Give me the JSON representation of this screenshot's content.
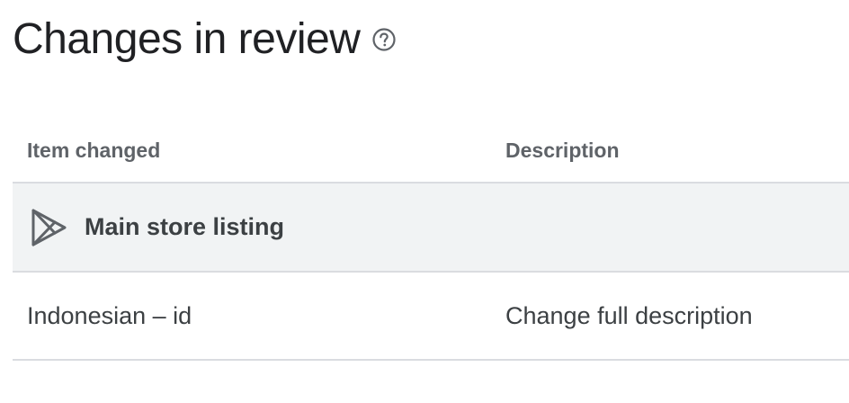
{
  "header": {
    "title": "Changes in review",
    "help_icon": "help-circle-icon"
  },
  "table": {
    "columns": [
      "Item changed",
      "Description"
    ],
    "group": {
      "icon": "google-play-icon",
      "label": "Main store listing"
    },
    "rows": [
      {
        "item": "Indonesian – id",
        "description": "Change full description"
      }
    ]
  },
  "colors": {
    "text": "#202124",
    "muted": "#5f6368",
    "divider": "#dadce0",
    "group_bg": "#f1f3f4"
  }
}
